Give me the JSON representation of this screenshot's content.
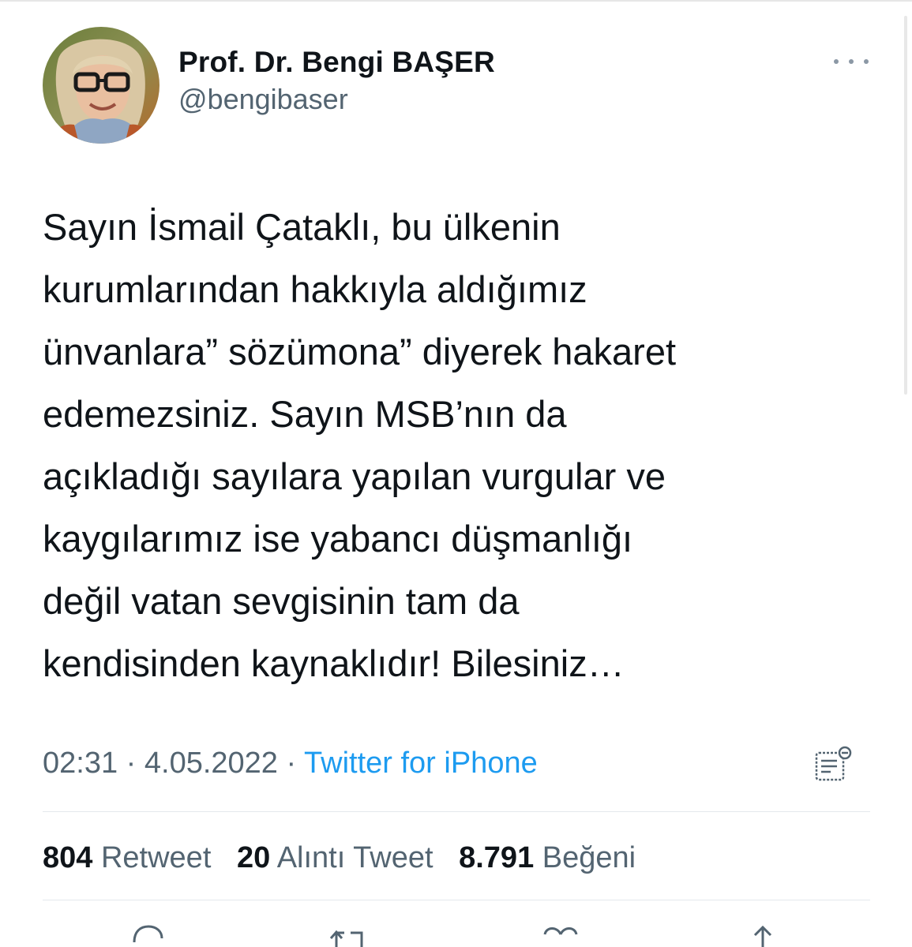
{
  "user": {
    "display_name": "Prof. Dr. Bengi BAŞER",
    "handle": "@bengibaser",
    "avatar_icon": "profile-photo",
    "more_icon": "more-options-icon"
  },
  "tweet": {
    "text": "Sayın İsmail Çataklı, bu ülkenin\nkurumlarından hakkıyla aldığımız\nünvanlara” sözümona” diyerek hakaret\nedemezsiniz. Sayın MSB’nın da\naçıkladığı sayılara yapılan vurgular ve\nkaygılarımız ise yabancı düşmanlığı\ndeğil vatan sevgisinin tam da\nkendisinden kaynaklıdır! Bilesiniz…",
    "time": "02:31",
    "separator": "·",
    "date": "4.05.2022",
    "source": "Twitter for iPhone",
    "analytics_icon": "tweet-analytics-icon"
  },
  "stats": {
    "retweets": {
      "count": "804",
      "label": "Retweet"
    },
    "quotes": {
      "count": "20",
      "label": "Alıntı Tweet"
    },
    "likes": {
      "count": "8.791",
      "label": "Beğeni"
    }
  },
  "actions": [
    "reply-icon",
    "retweet-icon",
    "like-icon",
    "share-icon"
  ],
  "colors": {
    "text": "#0f1419",
    "secondary": "#536471",
    "link": "#1d9bf0",
    "divider": "#e4e8ec"
  }
}
